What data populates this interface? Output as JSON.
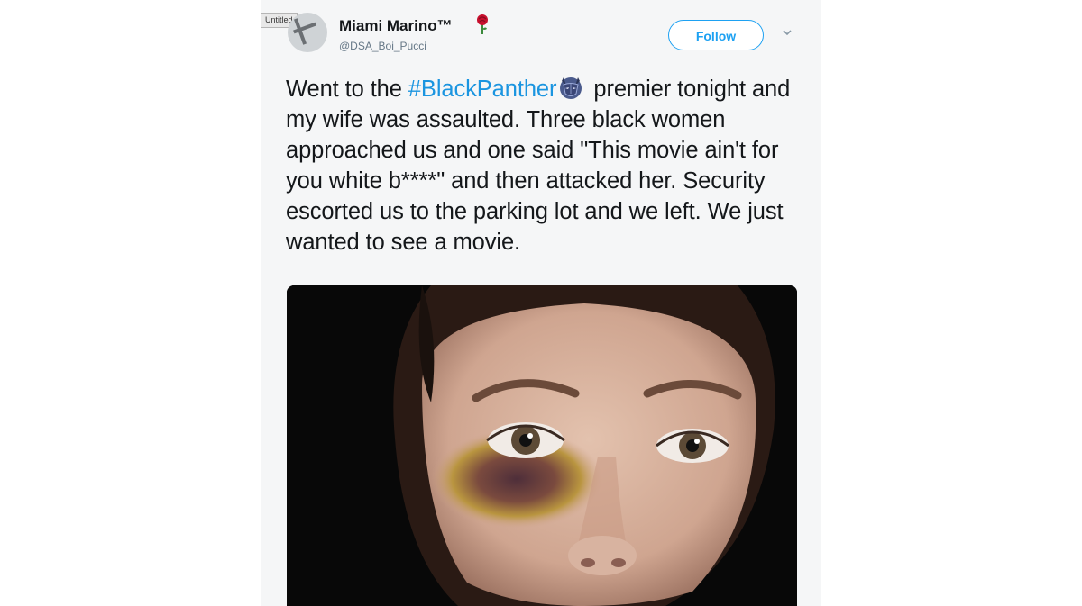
{
  "window": {
    "label": "Untitled"
  },
  "user": {
    "name": "Miami Marino™",
    "handle": "@DSA_Boi_Pucci"
  },
  "actions": {
    "follow_label": "Follow"
  },
  "tweet": {
    "text_before": "Went to the ",
    "hashtag": "#BlackPanther",
    "text_after": " premier tonight and my wife was assaulted. Three black women approached us and one said \"This movie ain't for you white b****\" and then attacked her. Security escorted us to the parking lot and we left. We just wanted to see a movie."
  },
  "icons": {
    "rose": "rose-icon",
    "panther": "black-panther-emoji-icon",
    "caret": "chevron-down-icon"
  },
  "colors": {
    "link": "#1b95e0",
    "follow": "#1da1f2",
    "text": "#14171a",
    "secondary": "#657786",
    "card_bg": "#f5f6f7"
  }
}
